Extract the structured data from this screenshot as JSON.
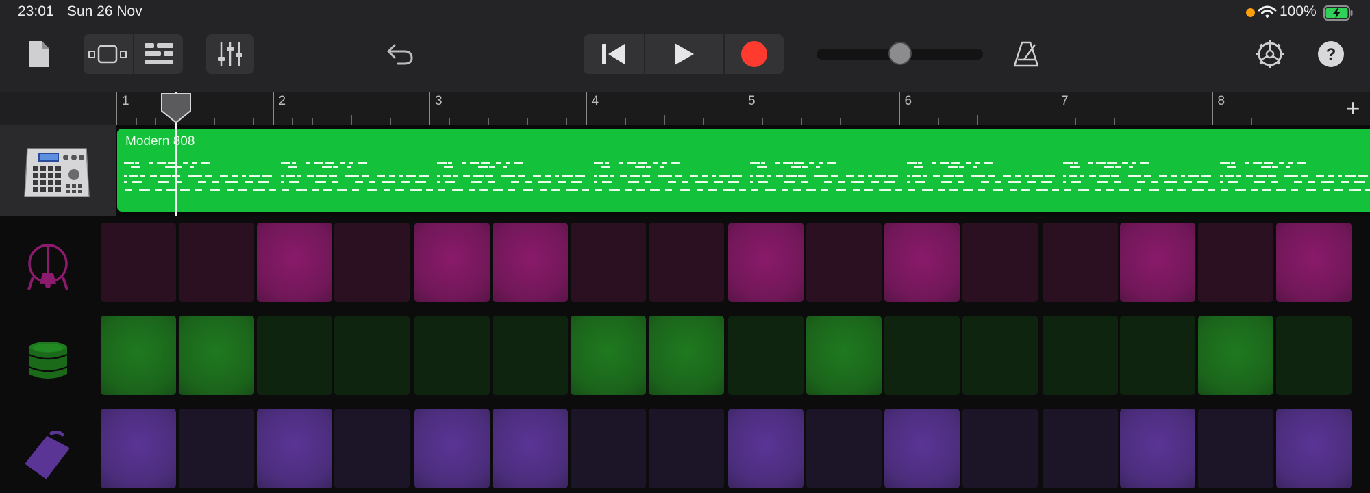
{
  "status_bar": {
    "time": "23:01",
    "date": "Sun 26 Nov",
    "battery": "100%",
    "recording_dot_color": "#ff9f0a"
  },
  "toolbar": {
    "icons": [
      "document-icon",
      "view-toggle-icon",
      "tracks-view-icon",
      "mixer-icon",
      "undo-icon",
      "go-to-start-icon",
      "play-icon",
      "record-icon",
      "metronome-icon",
      "settings-icon",
      "help-icon"
    ],
    "volume_level": 0.51,
    "record_color": "#ff3b30"
  },
  "ruler": {
    "bars": [
      "1",
      "2",
      "3",
      "4",
      "5",
      "6",
      "7",
      "8"
    ],
    "add_label": "+"
  },
  "track": {
    "region_name": "Modern 808",
    "region_color": "#14c13b",
    "instrument_icon": "drum-machine-icon"
  },
  "sequencer": {
    "rows": [
      {
        "icon": "kick-drum-icon",
        "color_on": "#8a1a6b",
        "color_off": "#2a1020",
        "steps": [
          0,
          0,
          1,
          0,
          1,
          1,
          0,
          0,
          1,
          0,
          1,
          0,
          0,
          1,
          0,
          1
        ]
      },
      {
        "icon": "snare-drum-icon",
        "color_on": "#1f7a1f",
        "color_off": "#0f240f",
        "steps": [
          1,
          1,
          0,
          0,
          0,
          0,
          1,
          1,
          0,
          1,
          0,
          0,
          0,
          0,
          1,
          0
        ]
      },
      {
        "icon": "cowbell-icon",
        "color_on": "#5a3596",
        "color_off": "#1c1528",
        "steps": [
          1,
          0,
          1,
          0,
          1,
          1,
          0,
          0,
          1,
          0,
          1,
          0,
          0,
          1,
          0,
          1
        ]
      }
    ]
  }
}
